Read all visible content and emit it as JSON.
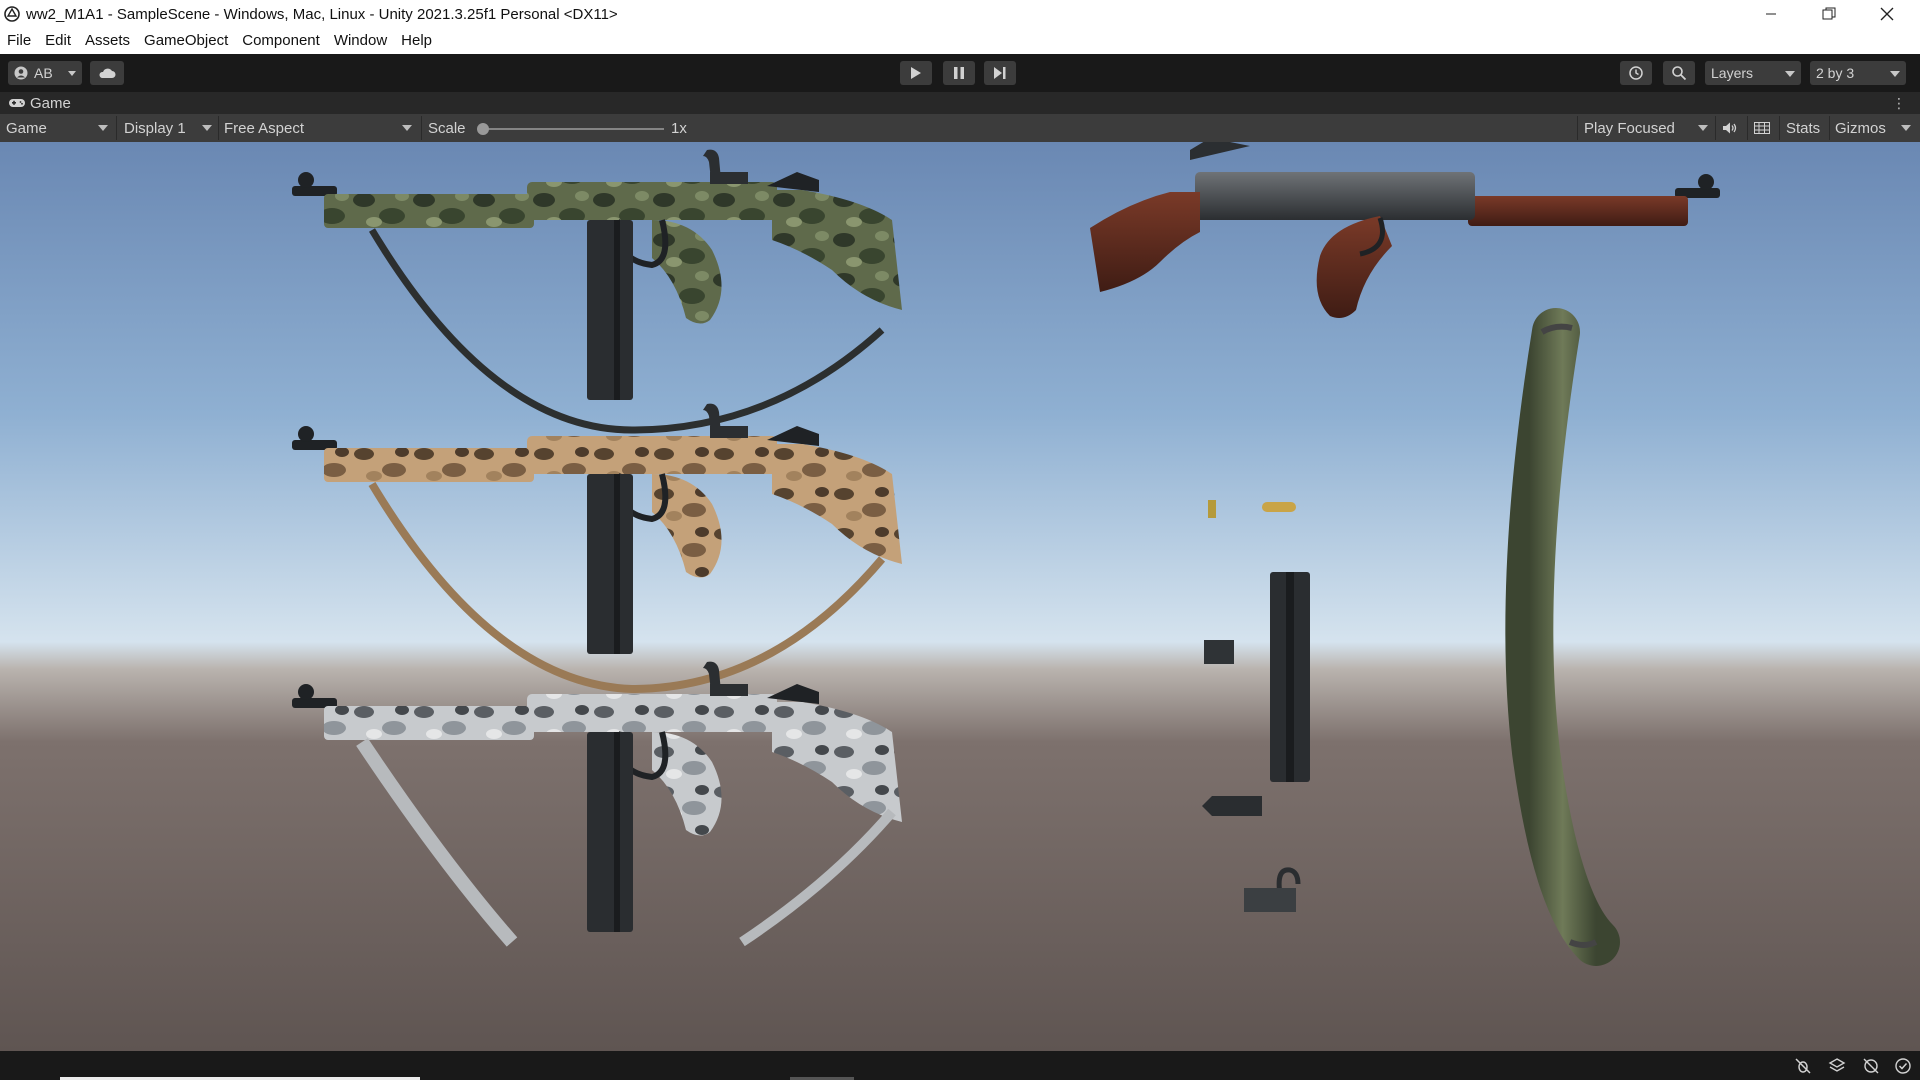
{
  "window": {
    "title": "ww2_M1A1 - SampleScene - Windows, Mac, Linux - Unity 2021.3.25f1 Personal <DX11>",
    "controls": [
      "minimize-icon",
      "restore-icon",
      "close-icon"
    ]
  },
  "menu": [
    "File",
    "Edit",
    "Assets",
    "GameObject",
    "Component",
    "Window",
    "Help"
  ],
  "toolbar": {
    "account_label": "AB",
    "layers_label": "Layers",
    "layout_label": "2 by 3",
    "icons": [
      "account-icon",
      "cloud-icon",
      "play-icon",
      "pause-icon",
      "step-icon",
      "history-icon",
      "search-icon"
    ]
  },
  "game_tab": {
    "label": "Game"
  },
  "game_toolbar": {
    "view_select": "Game",
    "display_select": "Display 1",
    "aspect_select": "Free Aspect",
    "scale_label": "Scale",
    "scale_value": "1x",
    "play_mode_select": "Play Focused",
    "stats_label": "Stats",
    "gizmos_label": "Gizmos"
  },
  "viewport": {
    "sky_top": "#6d8bb6",
    "horizon": "#d9e6f0",
    "ground": "#6e625e",
    "camo_green": [
      "#3f4a33",
      "#6c7756",
      "#2b3326"
    ],
    "camo_tan": [
      "#c9a77c",
      "#5a4636",
      "#8c6d4d"
    ],
    "camo_snow": [
      "#c6c9cc",
      "#5d6166",
      "#9aa0a5"
    ],
    "wood": "#5b2a1e"
  },
  "statusbar": {
    "icons": [
      "bug-icon",
      "layers-icon",
      "network-off-icon",
      "check-icon"
    ]
  }
}
